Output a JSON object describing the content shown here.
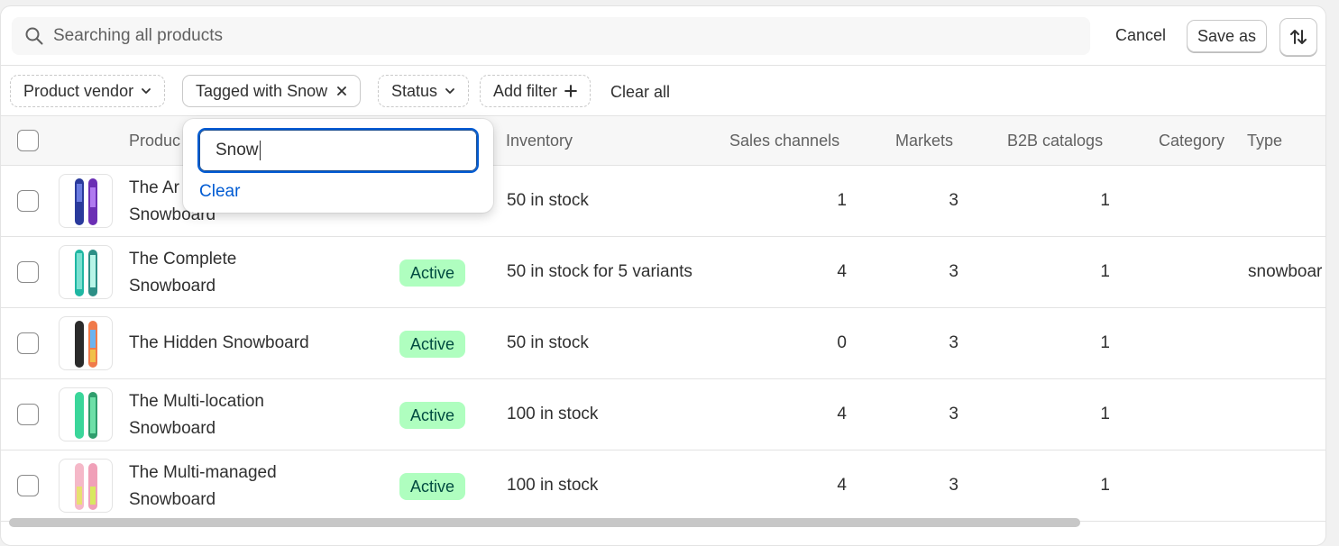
{
  "search": {
    "placeholder": "Searching all products",
    "value": ""
  },
  "toolbar": {
    "cancel_label": "Cancel",
    "save_as_label": "Save as"
  },
  "filters": {
    "product_vendor": "Product vendor",
    "tagged": "Tagged with Snow",
    "status": "Status",
    "add_filter": "Add filter",
    "clear_all": "Clear all"
  },
  "popover": {
    "input_value": "Snow",
    "clear_label": "Clear"
  },
  "table": {
    "headers": {
      "product": "Produc",
      "inventory": "Inventory",
      "sales_channels": "Sales channels",
      "markets": "Markets",
      "b2b_catalogs": "B2B catalogs",
      "category": "Category",
      "type": "Type"
    },
    "rows": [
      {
        "name_line1": "The Ar",
        "name_line2": "Snowboard",
        "status": "",
        "inventory": "50 in stock",
        "sales_channels": "1",
        "markets": "3",
        "b2b": "1",
        "category": "",
        "type": ""
      },
      {
        "name_line1": "The Complete",
        "name_line2": "Snowboard",
        "status": "Active",
        "inventory": "50 in stock for 5 variants",
        "sales_channels": "4",
        "markets": "3",
        "b2b": "1",
        "category": "",
        "type": "snowboar"
      },
      {
        "name_line1": "The Hidden Snowboard",
        "name_line2": "",
        "status": "Active",
        "inventory": "50 in stock",
        "sales_channels": "0",
        "markets": "3",
        "b2b": "1",
        "category": "",
        "type": ""
      },
      {
        "name_line1": "The Multi-location",
        "name_line2": "Snowboard",
        "status": "Active",
        "inventory": "100 in stock",
        "sales_channels": "4",
        "markets": "3",
        "b2b": "1",
        "category": "",
        "type": ""
      },
      {
        "name_line1": "The Multi-managed",
        "name_line2": "Snowboard",
        "status": "Active",
        "inventory": "100 in stock",
        "sales_channels": "4",
        "markets": "3",
        "b2b": "1",
        "category": "",
        "type": ""
      }
    ]
  },
  "colors": {
    "accent": "#005bd3",
    "active_badge_bg": "#affebf",
    "active_badge_text": "#014b40"
  },
  "icons": {
    "search": "search-icon",
    "sort": "sort-icon",
    "chevron": "chevron-down-icon",
    "close": "close-icon",
    "plus": "plus-icon"
  }
}
